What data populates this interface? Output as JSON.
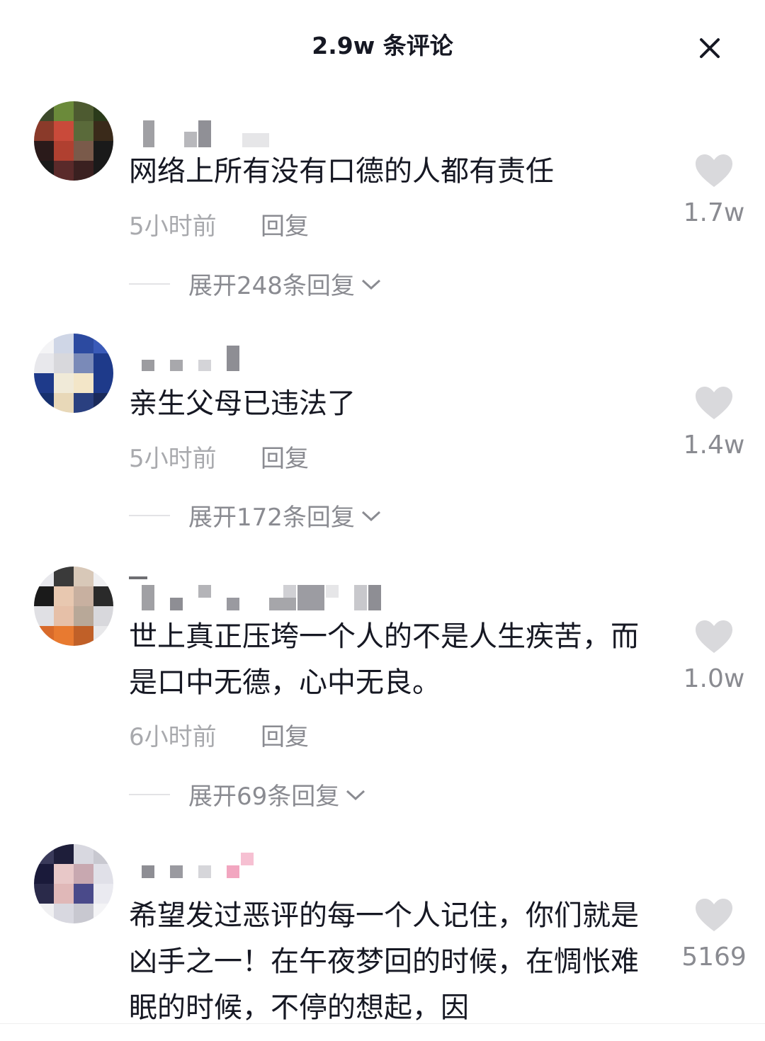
{
  "header": {
    "title": "2.9w 条评论",
    "close_icon": "close-icon"
  },
  "colors": {
    "text_primary": "#161823",
    "text_secondary": "#8a8b91",
    "heart": "#d9d9dc"
  },
  "comments": [
    {
      "content": "网络上所有没有口德的人都有责任",
      "time": "5小时前",
      "reply_label": "回复",
      "expand_label": "展开248条回复",
      "likes": "1.7w"
    },
    {
      "content": "亲生父母已违法了",
      "time": "5小时前",
      "reply_label": "回复",
      "expand_label": "展开172条回复",
      "likes": "1.4w"
    },
    {
      "content": "世上真正压垮一个人的不是人生疾苦，而是口中无德，心中无良。",
      "time": "6小时前",
      "reply_label": "回复",
      "expand_label": "展开69条回复",
      "likes": "1.0w"
    },
    {
      "content": "希望发过恶评的每一个人记住，你们就是凶手之一！在午夜梦回的时候，在惆怅难眠的时候，不停的想起，因",
      "likes": "5169"
    }
  ]
}
